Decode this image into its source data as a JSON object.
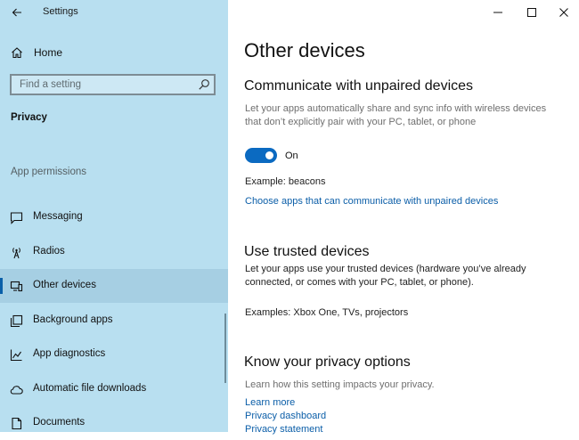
{
  "window": {
    "title": "Settings"
  },
  "sidebar": {
    "home_label": "Home",
    "search_placeholder": "Find a setting",
    "section_title": "Privacy",
    "group_label": "App permissions",
    "items": [
      {
        "label": "Messaging",
        "icon": "messaging-icon"
      },
      {
        "label": "Radios",
        "icon": "radio-tower-icon"
      },
      {
        "label": "Other devices",
        "icon": "other-devices-icon",
        "selected": true
      },
      {
        "label": "Background apps",
        "icon": "background-apps-icon"
      },
      {
        "label": "App diagnostics",
        "icon": "app-diagnostics-icon"
      },
      {
        "label": "Automatic file downloads",
        "icon": "cloud-icon"
      },
      {
        "label": "Documents",
        "icon": "document-icon"
      }
    ]
  },
  "main": {
    "page_title": "Other devices",
    "unpaired": {
      "heading": "Communicate with unpaired devices",
      "description": "Let your apps automatically share and sync info with wireless devices that don’t explicitly pair with your PC, tablet, or phone",
      "toggle_state": "On",
      "toggle_on": true,
      "example": "Example: beacons",
      "link": "Choose apps that can communicate with unpaired devices"
    },
    "trusted": {
      "heading": "Use trusted devices",
      "description": "Let your apps use your trusted devices (hardware you’ve already connected, or comes with your PC, tablet, or phone).",
      "examples": "Examples: Xbox One, TVs, projectors"
    },
    "privacy": {
      "heading": "Know your privacy options",
      "description": "Learn how this setting impacts your privacy.",
      "links": [
        "Learn more",
        "Privacy dashboard",
        "Privacy statement"
      ]
    }
  },
  "colors": {
    "sidebar_bg": "#b8dff0",
    "accent": "#0b6ac1",
    "link": "#0b5ea8"
  }
}
